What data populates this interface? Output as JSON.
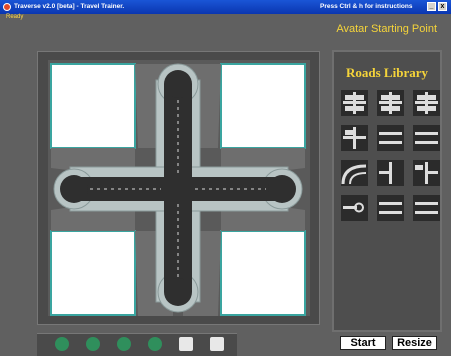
{
  "window": {
    "title": "Traverse v2.0 [beta] - Travel Trainer.",
    "hint": "Press Ctrl & h for instructions",
    "minimize_label": "_",
    "close_label": "x"
  },
  "status": "Ready",
  "mode_title": "Avatar Starting Point",
  "library": {
    "title": "Roads Library",
    "tiles": [
      "cross-grid",
      "cross-grid",
      "cross-grid",
      "cross-t",
      "straight-double",
      "straight-double",
      "curve",
      "corner",
      "t-junction",
      "dead-end",
      "straight-double",
      "straight-double"
    ]
  },
  "toolbar": {
    "buttons": [
      "delete-icon",
      "rotate-icon",
      "grid-icon",
      "zoom-icon",
      "save-icon",
      "open-icon"
    ]
  },
  "actions": {
    "start_label": "Start",
    "resize_label": "Resize"
  }
}
